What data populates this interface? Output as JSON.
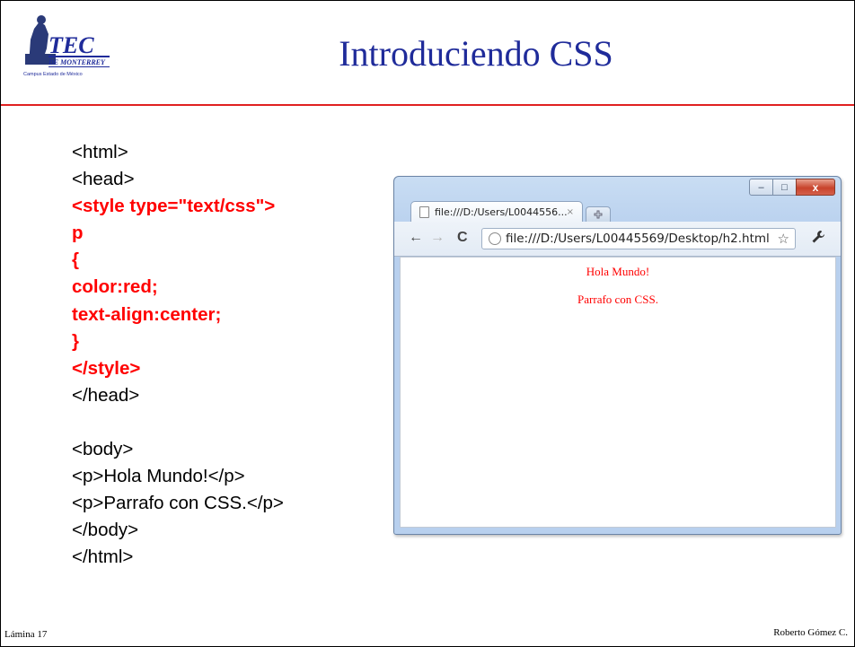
{
  "slide": {
    "title": "Introduciendo CSS",
    "footer_left": "Lámina 17",
    "footer_right": "Roberto Gómez C.",
    "logo": {
      "text": "TEC",
      "subtext": "DE MONTERREY",
      "campus": "Campus Estado de México"
    }
  },
  "code_lines": [
    {
      "text": "<html>",
      "style": "normal"
    },
    {
      "text": "<head>",
      "style": "normal"
    },
    {
      "text": "<style type=\"text/css\">",
      "style": "red-bold"
    },
    {
      "text": "p",
      "style": "red-bold"
    },
    {
      "text": "{",
      "style": "red-bold"
    },
    {
      "text": "color:red;",
      "style": "red-bold"
    },
    {
      "text": "text-align:center;",
      "style": "red-bold"
    },
    {
      "text": "}",
      "style": "red-bold"
    },
    {
      "text": "</style>",
      "style": "red-bold"
    },
    {
      "text": "</head>",
      "style": "normal"
    },
    {
      "text": "",
      "style": "normal"
    },
    {
      "text": "<body>",
      "style": "normal"
    },
    {
      "text": "<p>Hola Mundo!</p>",
      "style": "normal"
    },
    {
      "text": "<p>Parrafo con CSS.</p>",
      "style": "normal"
    },
    {
      "text": "</body>",
      "style": "normal"
    },
    {
      "text": "</html>",
      "style": "normal"
    }
  ],
  "browser": {
    "tab_label": "file:///D:/Users/L0044556...",
    "tab_close": "×",
    "url": "file:///D:/Users/L00445569/Desktop/h2.html",
    "content": [
      "Hola Mundo!",
      "Parrafo con CSS."
    ],
    "window_controls": {
      "minimize": "–",
      "maximize": "□",
      "close": "x"
    }
  },
  "colors": {
    "title": "#1f2b9a",
    "rule": "#e02020",
    "code_highlight": "#ff0000"
  }
}
